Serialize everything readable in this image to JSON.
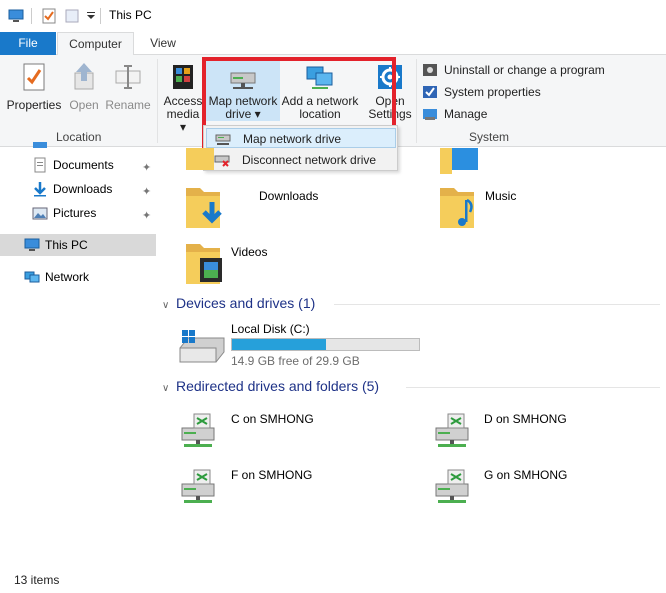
{
  "titlebar": {
    "title": "This PC",
    "icons": [
      "computer-icon",
      "properties-check-icon",
      "new-folder-icon",
      "customize-dropdown-icon"
    ]
  },
  "tabs": {
    "file": "File",
    "computer": "Computer",
    "view": "View"
  },
  "ribbon": {
    "location": {
      "label": "Location",
      "properties": "Properties",
      "open": "Open",
      "rename": "Rename"
    },
    "network": {
      "access_media_line1": "Access",
      "access_media_line2": "media",
      "map_drive_line1": "Map network",
      "map_drive_line2": "drive",
      "add_location_line1": "Add a network",
      "add_location_line2": "location",
      "open_settings_line1": "Open",
      "open_settings_line2": "Settings"
    },
    "system": {
      "label": "System",
      "uninstall": "Uninstall or change a program",
      "system_properties": "System properties",
      "manage": "Manage"
    }
  },
  "dropdown": {
    "items": [
      "Map network drive",
      "Disconnect network drive"
    ]
  },
  "nav": {
    "items": [
      {
        "label": "Documents",
        "pinned": true
      },
      {
        "label": "Downloads",
        "pinned": true
      },
      {
        "label": "Pictures",
        "pinned": true
      },
      {
        "label": "This PC",
        "selected": true
      },
      {
        "label": "Network"
      }
    ]
  },
  "content": {
    "folders": [
      "Downloads",
      "Music",
      "Videos"
    ],
    "devices_header": "Devices and drives (1)",
    "local_disk": {
      "name": "Local Disk (C:)",
      "free_text": "14.9 GB free of 29.9 GB",
      "used_fraction": 0.5
    },
    "redirected_header": "Redirected drives and folders (5)",
    "redirected": [
      "C on SMHONG",
      "D on SMHONG",
      "F on SMHONG",
      "G on SMHONG"
    ]
  },
  "status": {
    "items_count": "13 items"
  },
  "colors": {
    "accent": "#1979ca",
    "highlight": "#e3222b",
    "drive_fill": "#26a0da",
    "section_header": "#1e3287"
  }
}
